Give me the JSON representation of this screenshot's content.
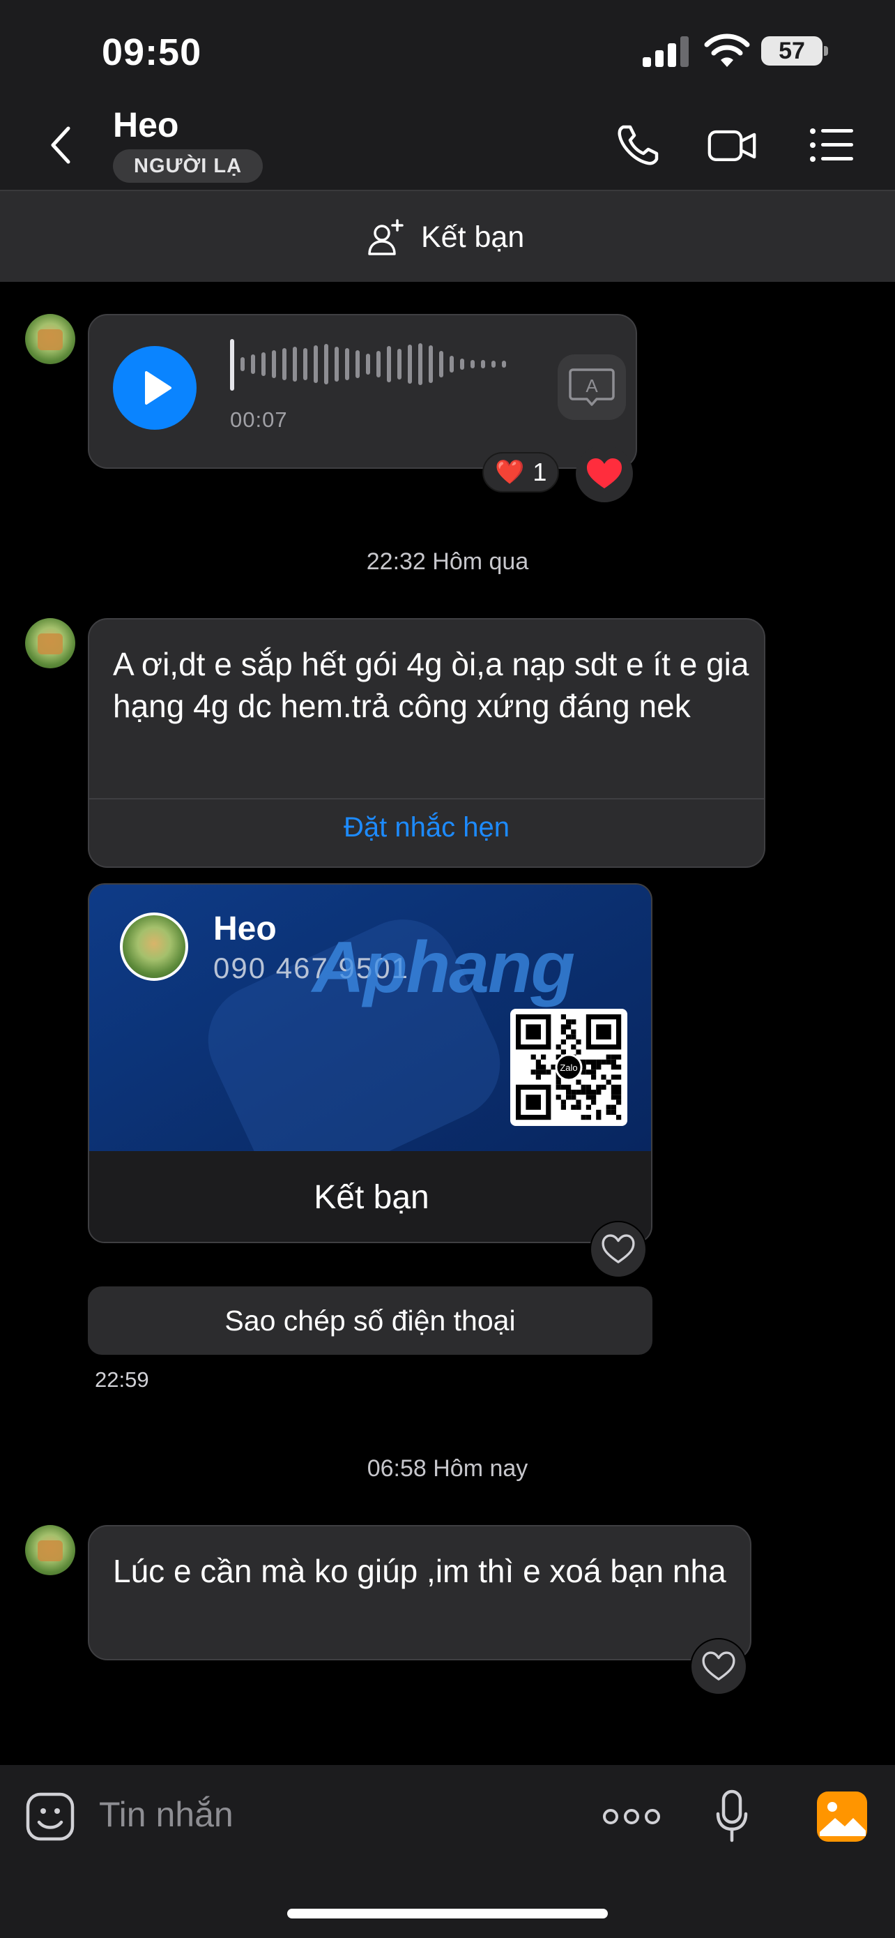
{
  "status_bar": {
    "time": "09:50",
    "battery": "57"
  },
  "header": {
    "title": "Heo",
    "badge": "NGƯỜI LẠ"
  },
  "add_friend_bar": {
    "label": "Kết bạn"
  },
  "voice_message": {
    "duration": "00:07",
    "reaction_count": "1",
    "reaction_emoji": "❤️",
    "quick_reaction": "❤️"
  },
  "divider_yesterday": "22:32 Hôm qua",
  "message_1": {
    "text": "A ơi,dt e sắp hết gói 4g òi,a nạp sdt e ít e gia hạng 4g dc hem.trả công xứng đáng nek",
    "action": "Đặt nhắc hẹn"
  },
  "contact_card": {
    "name": "Heo",
    "phone": "090 467 9501",
    "qr_label": "Zalo",
    "watermark": "Aphang",
    "button": "Kết bạn"
  },
  "copy_phone": "Sao chép số điện thoại",
  "card_time": "22:59",
  "divider_today": "06:58 Hôm nay",
  "message_2": {
    "text": "Lúc e cần mà ko giúp ,im thì e xoá bạn nha"
  },
  "input": {
    "placeholder": "Tin nhắn"
  },
  "colors": {
    "accent": "#0a84ff",
    "link": "#1d8bff",
    "gallery": "#ff9500",
    "card_bg": "#0e3b87"
  }
}
